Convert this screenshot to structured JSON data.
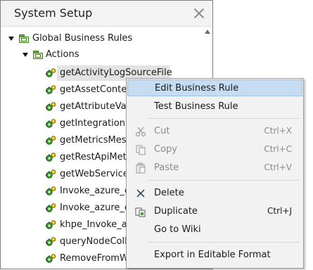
{
  "panel": {
    "title": "System Setup"
  },
  "tree": {
    "root": "Global Business Rules",
    "folder": "Actions",
    "items": [
      "getActivityLogSourceFile",
      "getAssetConten",
      "getAttributeVali",
      "getIntegrationP",
      "getMetricsMessa",
      "getRestApiMetri",
      "getWebServiceI",
      "Invoke_azure_c",
      "Invoke_azure_c",
      "khpe_Invoke_a",
      "queryNodeColle",
      "RemoveFromWi"
    ]
  },
  "context_menu": {
    "edit": "Edit Business Rule",
    "test": "Test Business Rule",
    "cut": "Cut",
    "cut_shortcut": "Ctrl+X",
    "copy": "Copy",
    "copy_shortcut": "Ctrl+C",
    "paste": "Paste",
    "paste_shortcut": "Ctrl+V",
    "delete": "Delete",
    "duplicate": "Duplicate",
    "duplicate_shortcut": "Ctrl+J",
    "wiki": "Go to Wiki",
    "export": "Export in Editable Format"
  }
}
